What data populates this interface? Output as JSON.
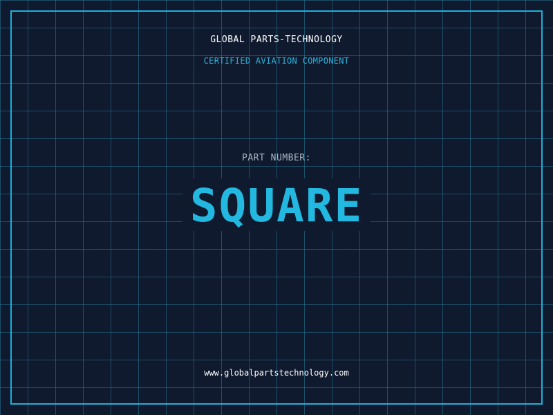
{
  "header": {
    "company": "GLOBAL PARTS-TECHNOLOGY",
    "subtitle": "CERTIFIED AVIATION COMPONENT"
  },
  "part": {
    "label": "PART NUMBER:",
    "number": "SQUARE"
  },
  "footer": {
    "website": "www.globalpartstechnology.com"
  },
  "colors": {
    "background": "#101a2e",
    "grid": "#26789a",
    "accent": "#22b8e0",
    "frame": "#1fb0d8",
    "label": "#a9b4c4",
    "text": "#ffffff"
  }
}
